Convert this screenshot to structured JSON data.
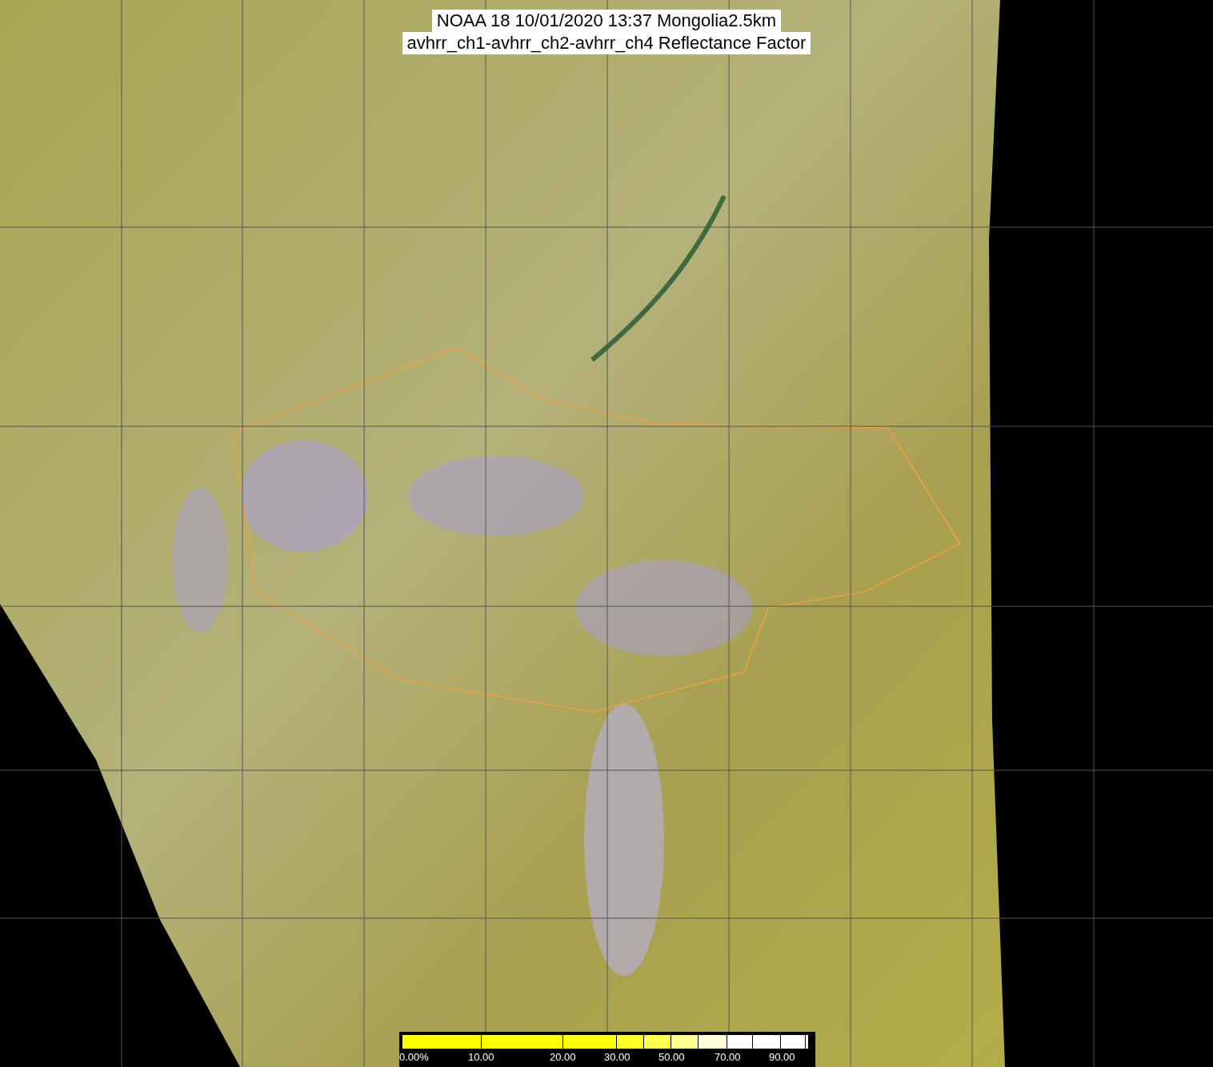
{
  "title_lines": [
    "NOAA 18 10/01/2020 13:37 Mongolia2.5km",
    "avhrr_ch1-avhrr_ch2-avhrr_ch4 Reflectance Factor"
  ],
  "legend": {
    "labels": [
      "0.00%",
      "10.00",
      "20.00",
      "30.00",
      "50.00",
      "70.00",
      "90.00"
    ]
  }
}
